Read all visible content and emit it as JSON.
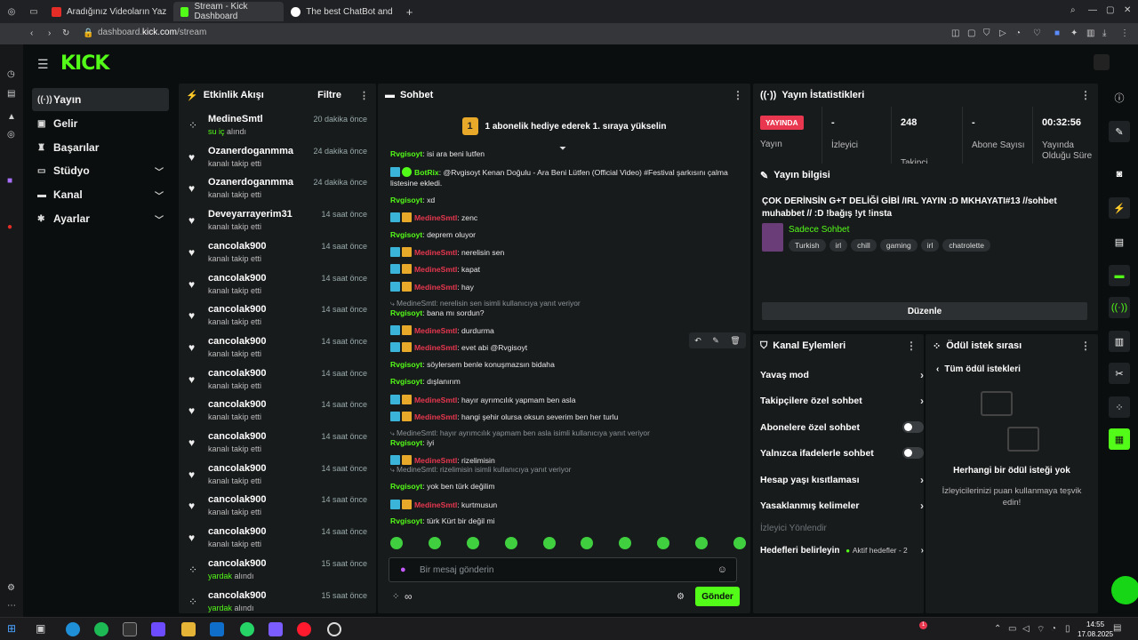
{
  "browser": {
    "tabs": [
      {
        "title": "Aradığınız Videoların Yaz",
        "color": "#e52d27"
      },
      {
        "title": "Stream - Kick Dashboard",
        "color": "#53fc18"
      },
      {
        "title": "The best ChatBot and",
        "color": "#ffffff"
      }
    ],
    "new_tab": "+",
    "url_prefix": "dashboard.",
    "url_host": "kick.com",
    "url_path": "/stream"
  },
  "kick": {
    "logo": "KICK"
  },
  "sidebar": {
    "items": [
      {
        "label": "Yayın",
        "icon": "broadcast-icon",
        "glyph": "((·))",
        "active": true
      },
      {
        "label": "Gelir",
        "icon": "money-icon",
        "glyph": "▣"
      },
      {
        "label": "Başarılar",
        "icon": "trophy-icon",
        "glyph": "♜"
      },
      {
        "label": "Stüdyo",
        "icon": "studio-icon",
        "glyph": "▭",
        "expand": true
      },
      {
        "label": "Kanal",
        "icon": "channel-icon",
        "glyph": "▬",
        "expand": true
      },
      {
        "label": "Ayarlar",
        "icon": "gear-icon",
        "glyph": "✱",
        "expand": true
      }
    ]
  },
  "activity": {
    "title": "Etkinlik Akışı",
    "filter": "Filtre",
    "items": [
      {
        "name": "MedineSmtl",
        "time": "20 dakika önce",
        "hl": "su iç",
        "desc": " alındı",
        "type": "reward"
      },
      {
        "name": "Ozanerdoganmma",
        "time": "24 dakika önce",
        "desc": "kanalı takip etti",
        "type": "follow"
      },
      {
        "name": "Ozanerdoganmma",
        "time": "24 dakika önce",
        "desc": "kanalı takip etti",
        "type": "follow"
      },
      {
        "name": "Deveyarrayerim31",
        "time": "14 saat önce",
        "desc": "kanalı takip etti",
        "type": "follow"
      },
      {
        "name": "cancolak900",
        "time": "14 saat önce",
        "desc": "kanalı takip etti",
        "type": "follow"
      },
      {
        "name": "cancolak900",
        "time": "14 saat önce",
        "desc": "kanalı takip etti",
        "type": "follow"
      },
      {
        "name": "cancolak900",
        "time": "14 saat önce",
        "desc": "kanalı takip etti",
        "type": "follow"
      },
      {
        "name": "cancolak900",
        "time": "14 saat önce",
        "desc": "kanalı takip etti",
        "type": "follow"
      },
      {
        "name": "cancolak900",
        "time": "14 saat önce",
        "desc": "kanalı takip etti",
        "type": "follow"
      },
      {
        "name": "cancolak900",
        "time": "14 saat önce",
        "desc": "kanalı takip etti",
        "type": "follow"
      },
      {
        "name": "cancolak900",
        "time": "14 saat önce",
        "desc": "kanalı takip etti",
        "type": "follow"
      },
      {
        "name": "cancolak900",
        "time": "14 saat önce",
        "desc": "kanalı takip etti",
        "type": "follow"
      },
      {
        "name": "cancolak900",
        "time": "14 saat önce",
        "desc": "kanalı takip etti",
        "type": "follow"
      },
      {
        "name": "cancolak900",
        "time": "14 saat önce",
        "desc": "kanalı takip etti",
        "type": "follow"
      },
      {
        "name": "cancolak900",
        "time": "15 saat önce",
        "hl": "yardak",
        "desc": " alındı",
        "type": "reward"
      },
      {
        "name": "cancolak900",
        "time": "15 saat önce",
        "hl": "yardak",
        "desc": " alındı",
        "type": "reward"
      }
    ]
  },
  "chat": {
    "title": "Sohbet",
    "banner_num": "1",
    "banner": "1 abonelik hediye ederek 1. sıraya yükselin",
    "lines": [
      {
        "kind": "msg",
        "user": "Rvgisoyt",
        "text": ": isi ara beni lutfen",
        "red": false,
        "badges": false
      },
      {
        "kind": "msg",
        "user": "BotRix",
        "text": ": @Rvgisoyt Kenan Doğulu - Ara Beni Lütfen (Official Video) #Festival şarkısını çalma",
        "red": false,
        "badges": true,
        "bot": true
      },
      {
        "kind": "cont",
        "text": "listesine ekledi."
      },
      {
        "kind": "msg",
        "user": "Rvgisoyt",
        "text": ": xd",
        "red": false,
        "badges": false
      },
      {
        "kind": "msg",
        "user": "MedineSmtl",
        "text": ": zenc",
        "red": true,
        "badges": true
      },
      {
        "kind": "msg",
        "user": "Rvgisoyt",
        "text": ": deprem oluyor",
        "red": false,
        "badges": false
      },
      {
        "kind": "msg",
        "user": "MedineSmtl",
        "text": ": nerelisin sen",
        "red": true,
        "badges": true
      },
      {
        "kind": "msg",
        "user": "MedineSmtl",
        "text": ": kapat",
        "red": true,
        "badges": true
      },
      {
        "kind": "msg",
        "user": "MedineSmtl",
        "text": ": hay",
        "red": true,
        "badges": true
      },
      {
        "kind": "reply",
        "text": "⤷ MedineSmtl: nerelisin sen isimli kullanıcıya yanıt veriyor"
      },
      {
        "kind": "msg",
        "user": "Rvgisoyt",
        "text": ": bana mı sordun?",
        "red": false,
        "badges": false
      },
      {
        "kind": "msg",
        "user": "MedineSmtl",
        "text": ": durdurma",
        "red": true,
        "badges": true
      },
      {
        "kind": "msg",
        "user": "MedineSmtl",
        "text": ": evet abi @Rvgisoyt",
        "red": true,
        "badges": true
      },
      {
        "kind": "msg",
        "user": "Rvgisoyt",
        "text": ": söylersem benle konuşmazsın bidaha",
        "red": false,
        "badges": false
      },
      {
        "kind": "msg",
        "user": "Rvgisoyt",
        "text": ": dışlanırım",
        "red": false,
        "badges": false
      },
      {
        "kind": "msg",
        "user": "MedineSmtl",
        "text": ": hayır ayrımcılık yapmam ben asla",
        "red": true,
        "badges": true
      },
      {
        "kind": "msg",
        "user": "MedineSmtl",
        "text": ": hangi şehir olursa oksun severim ben her turlu",
        "red": true,
        "badges": true
      },
      {
        "kind": "reply",
        "text": "⤷ MedineSmtl: hayır ayrımcılık yapmam ben asla isimli kullanıcıya yanıt veriyor"
      },
      {
        "kind": "msg",
        "user": "Rvgisoyt",
        "text": ": iyi",
        "red": false,
        "badges": false
      },
      {
        "kind": "msg",
        "user": "MedineSmtl",
        "text": ": rizelimisin",
        "red": true,
        "badges": true
      },
      {
        "kind": "reply",
        "text": "⤷ MedineSmtl: rizelimisin isimli kullanıcıya yanıt veriyor"
      },
      {
        "kind": "msg",
        "user": "Rvgisoyt",
        "text": ": yok ben türk değilim",
        "red": false,
        "badges": false
      },
      {
        "kind": "msg",
        "user": "MedineSmtl",
        "text": ": kurtmusun",
        "red": true,
        "badges": true
      },
      {
        "kind": "msg",
        "user": "Rvgisoyt",
        "text": ": türk Kürt bir değil mi",
        "red": false,
        "badges": false
      }
    ],
    "input_placeholder": "Bir mesaj gönderin",
    "send": "Gönder",
    "points": "∞"
  },
  "stats": {
    "title": "Yayın İstatistikleri",
    "live_badge": "YAYINDA",
    "live_label": "Yayın",
    "items": [
      {
        "value": "-",
        "label": "İzleyici"
      },
      {
        "value": "248",
        "label": "Takipçi"
      },
      {
        "value": "-",
        "label": "Abone Sayısı"
      },
      {
        "value": "00:32:56",
        "label": "Yayında Olduğu Süre"
      }
    ]
  },
  "info": {
    "title": "Yayın bilgisi",
    "stream_title": "ÇOK DERİNSİN G+T DELİĞİ GİBİ /IRL YAYIN :D MKHAYATI#13 //sohbet muhabbet // :D !bağış !yt !insta",
    "category": "Sadece Sohbet",
    "tags": [
      "Turkish",
      "irl",
      "chill",
      "gaming",
      "irl",
      "chatrolette"
    ],
    "edit": "Düzenle"
  },
  "channel": {
    "title": "Kanal Eylemleri",
    "rows": [
      {
        "label": "Yavaş mod",
        "type": "arrow"
      },
      {
        "label": "Takipçilere özel sohbet",
        "type": "arrow"
      },
      {
        "label": "Abonelere özel sohbet",
        "type": "toggle"
      },
      {
        "label": "Yalnızca ifadelerle sohbet",
        "type": "toggle"
      },
      {
        "label": "Hesap yaşı kısıtlaması",
        "type": "arrow"
      },
      {
        "label": "Yasaklanmış kelimeler",
        "type": "arrow"
      }
    ],
    "redirect": "İzleyici Yönlendir",
    "goals": "Hedefleri belirleyin",
    "goals_status": "Aktif hedefler - 2"
  },
  "rewards": {
    "title": "Ödül istek sırası",
    "all": "Tüm ödül istekleri",
    "empty_title": "Herhangi bir ödül isteği yok",
    "empty_desc": "İzleyicilerinizi puan kullanmaya teşvik edin!"
  },
  "taskbar": {
    "time": "14:55",
    "date": "17.08.2025",
    "badge": "1"
  }
}
